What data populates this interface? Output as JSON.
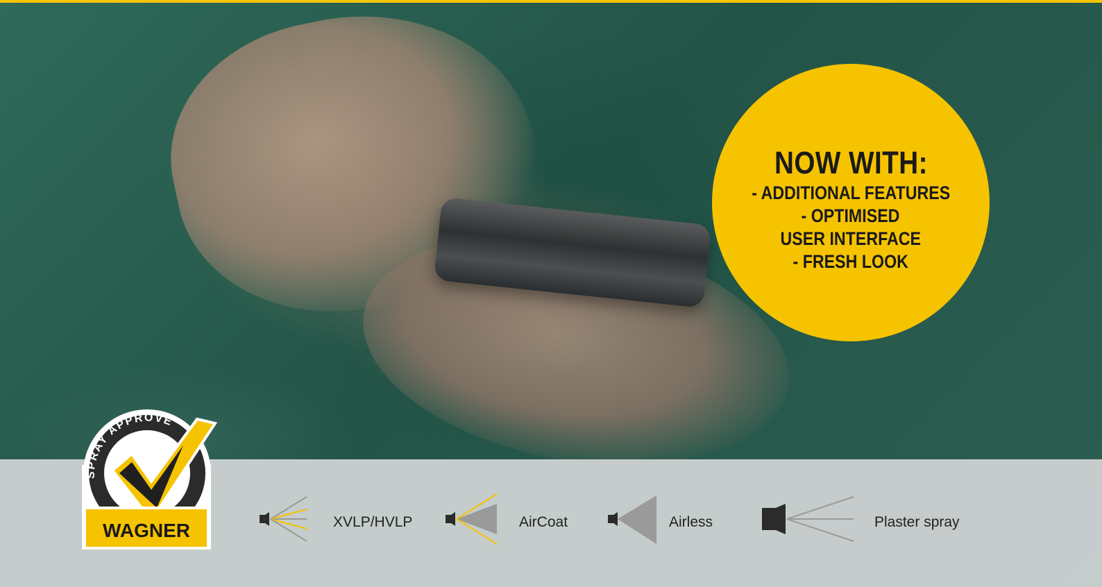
{
  "badge": {
    "title": "NOW WITH:",
    "lines": [
      "- ADDITIONAL FEATURES",
      "- OPTIMISED",
      "USER INTERFACE",
      "- FRESH LOOK"
    ]
  },
  "logo": {
    "arc_text": "SPRAY APPROVED",
    "brand": "WAGNER"
  },
  "spray_types": [
    {
      "label": "XVLP/HVLP",
      "icon": "xvlp-hvlp-spray-icon"
    },
    {
      "label": "AirCoat",
      "icon": "aircoat-spray-icon"
    },
    {
      "label": "Airless",
      "icon": "airless-spray-icon"
    },
    {
      "label": "Plaster spray",
      "icon": "plaster-spray-icon"
    }
  ],
  "colors": {
    "accent_yellow": "#f6c300",
    "footer_gray": "#d2d5d6",
    "icon_dark": "#2b2b2b",
    "icon_gray": "#9a9a9a"
  }
}
